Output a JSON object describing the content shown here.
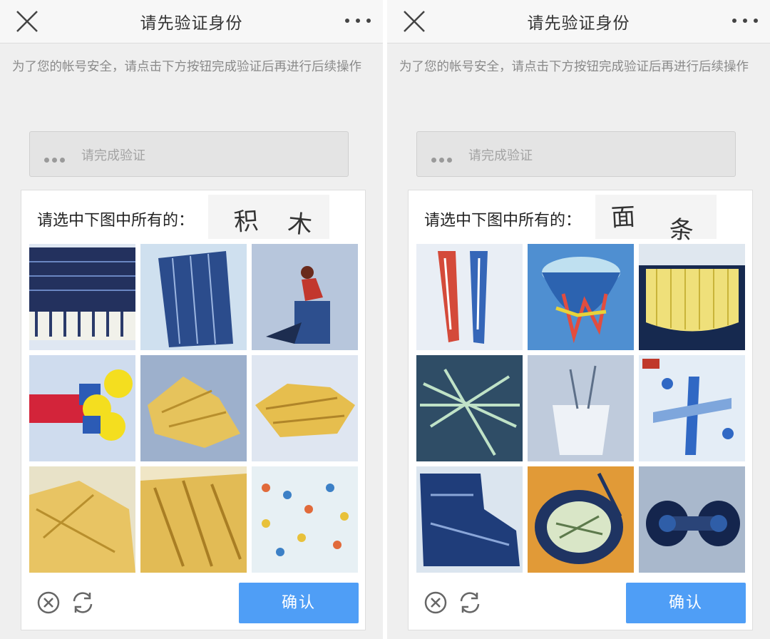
{
  "panels": [
    {
      "header": {
        "title": "请先验证身份",
        "close_icon": "close-icon",
        "more_icon": "more-dots-icon"
      },
      "notice": "为了您的帐号安全，请点击下方按钮完成验证后再进行后续操作",
      "verify_field": {
        "status": "请完成验证"
      },
      "captcha": {
        "prompt": "请选中下图中所有的：",
        "target_chars": [
          "积",
          "木"
        ],
        "tiles": [
          "blue-keyboard",
          "blue-building",
          "person-on-blocks",
          "colored-blocks",
          "fries",
          "fries-pile",
          "fries-close",
          "fries-heap",
          "colorful-pattern"
        ],
        "confirm_label": "确认",
        "close_icon": "circle-x-icon",
        "refresh_icon": "refresh-icon"
      }
    },
    {
      "header": {
        "title": "请先验证身份",
        "close_icon": "close-icon",
        "more_icon": "more-dots-icon"
      },
      "notice": "为了您的帐号安全，请点击下方按钮完成验证后再进行后续操作",
      "verify_field": {
        "status": "请完成验证"
      },
      "captcha": {
        "prompt": "请选中下图中所有的：",
        "target_chars": [
          "面",
          "条"
        ],
        "tiles": [
          "chopsticks",
          "bowl-colored",
          "noodles-yellow",
          "green-noodles",
          "cup",
          "toy-plane",
          "blue-shape",
          "noodle-bowl",
          "dark-objects"
        ],
        "confirm_label": "确认",
        "close_icon": "circle-x-icon",
        "refresh_icon": "refresh-icon"
      }
    }
  ],
  "colors": {
    "accent": "#4f9ef6",
    "background": "#efefef",
    "topbar": "#f7f7f7"
  }
}
